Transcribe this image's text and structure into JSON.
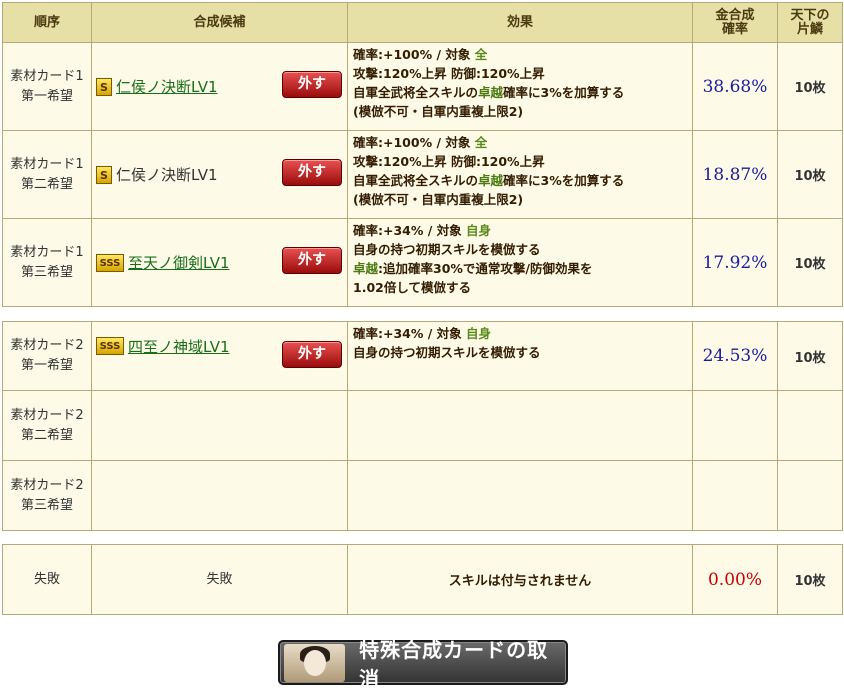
{
  "header": {
    "order": "順序",
    "candidate": "合成候補",
    "effect": "効果",
    "rate": "金合成\n確率",
    "shard": "天下の\n片鱗"
  },
  "group1": [
    {
      "order": "素材カード1\n第一希望",
      "rarity": "S",
      "skill": "仁侯ノ決断LV1",
      "linked": true,
      "remove": "外す",
      "effect_l1a": "確率:+100%  /  対象  ",
      "effect_l1b": "全",
      "effect_l2": "攻撃:120%上昇 防御:120%上昇",
      "effect_l3a": "自軍全武将全スキルの",
      "effect_l3b": "卓越",
      "effect_l3c": "確率に3%を加算する",
      "effect_l4": "(模倣不可・自軍内重複上限2)",
      "rate": "38.68%",
      "shard": "10枚"
    },
    {
      "order": "素材カード1\n第二希望",
      "rarity": "S",
      "skill": "仁侯ノ決断LV1",
      "linked": false,
      "remove": "外す",
      "effect_l1a": "確率:+100%  /  対象  ",
      "effect_l1b": "全",
      "effect_l2": "攻撃:120%上昇 防御:120%上昇",
      "effect_l3a": "自軍全武将全スキルの",
      "effect_l3b": "卓越",
      "effect_l3c": "確率に3%を加算する",
      "effect_l4": "(模倣不可・自軍内重複上限2)",
      "rate": "18.87%",
      "shard": "10枚"
    },
    {
      "order": "素材カード1\n第三希望",
      "rarity": "SSS",
      "skill": "至天ノ御剣LV1",
      "linked": true,
      "remove": "外す",
      "effect_l1a": "確率:+34%  /  対象  ",
      "effect_l1b": "自身",
      "effect_l2": "自身の持つ初期スキルを模倣する",
      "effect_l3a": "",
      "effect_l3b": "卓越",
      "effect_l3c": ":追加確率30%で通常攻撃/防御効果を",
      "effect_l4": "1.02倍して模倣する",
      "rate": "17.92%",
      "shard": "10枚"
    }
  ],
  "group2": [
    {
      "order": "素材カード2\n第一希望",
      "rarity": "SSS",
      "skill": "四至ノ神域LV1",
      "remove": "外す",
      "effect_l1a": "確率:+34%  /  対象  ",
      "effect_l1b": "自身",
      "effect_l2": "自身の持つ初期スキルを模倣する",
      "rate": "24.53%",
      "shard": "10枚"
    },
    {
      "order": "素材カード2\n第二希望"
    },
    {
      "order": "素材カード2\n第三希望"
    }
  ],
  "fail": {
    "order": "失敗",
    "candidate": "失敗",
    "effect": "スキルは付与されません",
    "rate": "0.00%",
    "shard": "10枚"
  },
  "cancel_button": "特殊合成カードの取消"
}
